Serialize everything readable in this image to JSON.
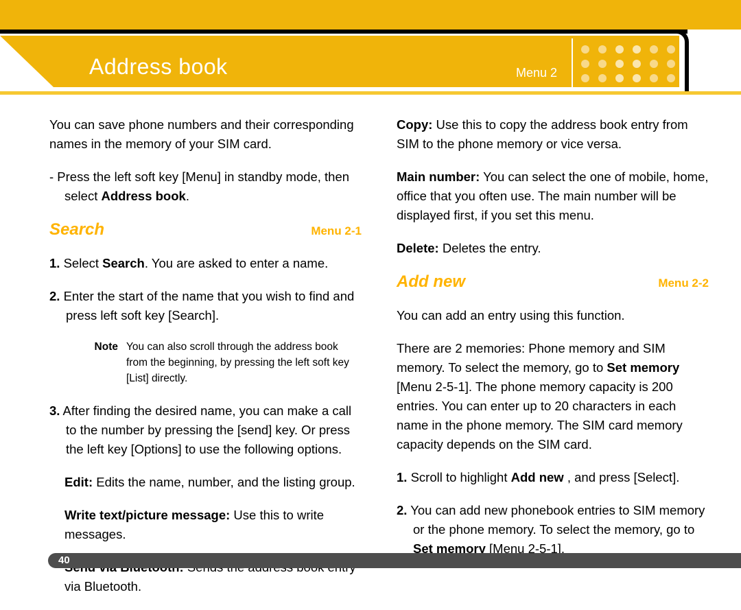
{
  "header": {
    "title": "Address book",
    "menu_tag": "Menu 2",
    "dot_rows": 3,
    "dot_cols": 6,
    "bar_color": "#F0B40A",
    "title_color": "#FFFFFF"
  },
  "theme": {
    "orange": "#F0B40A",
    "heading_orange": "#FFB300",
    "footer_gray": "#4D4D4D",
    "text_black": "#000000"
  },
  "left_column": {
    "intro": "You can save phone numbers and their corresponding names in the memory of your SIM card.",
    "bullet": {
      "prefix": "- Press the left soft key [Menu] in standby mode, then select ",
      "bold": "Address book",
      "suffix": "."
    },
    "section": {
      "title": "Search",
      "menu": "Menu 2-1"
    },
    "step1": {
      "num": "1.",
      "pre": " Select ",
      "bold": "Search",
      "post": ". You are asked to enter a name."
    },
    "step2": {
      "num": "2.",
      "text": " Enter the start of the name that you wish to find and press left soft key [Search]."
    },
    "note": {
      "label": "Note",
      "text": "You can also scroll through the address book from the beginning, by pressing the left soft key [List] directly."
    },
    "step3": {
      "num": "3.",
      "text": " After finding the desired name, you can make a call to the number by pressing the [send] key. Or press the left key [Options] to use the following options."
    },
    "options": [
      {
        "term": "Edit:",
        "desc": " Edits the name, number, and the listing group."
      },
      {
        "term": "Write text/picture message:",
        "desc": " Use this to write messages."
      },
      {
        "term": "Send via Bluetooth:",
        "desc": " Sends the address book entry via Bluetooth."
      }
    ]
  },
  "right_column": {
    "options": [
      {
        "term": "Copy:",
        "desc": " Use this to copy the address book entry from SIM to the phone memory or vice versa."
      },
      {
        "term": "Main number:",
        "desc": " You can select the one of mobile, home, office that you often use. The main number will be displayed first, if you set this menu."
      },
      {
        "term": "Delete:",
        "desc": " Deletes the entry."
      }
    ],
    "section": {
      "title": "Add new",
      "menu": "Menu 2-2"
    },
    "intro": "You can add an entry using this function.",
    "memory_para": {
      "pre": "There are 2 memories: Phone memory and SIM memory. To select the memory, go to ",
      "bold": "Set memory",
      "post": " [Menu 2-5-1]. The phone memory capacity is 200 entries. You can enter up to 20 characters in each name in the phone memory. The SIM card memory capacity depends on the SIM card."
    },
    "step1": {
      "num": "1.",
      "pre": " Scroll to highlight ",
      "bold": "Add new",
      "post": " , and press [Select]."
    },
    "step2": {
      "num": "2.",
      "pre": " You can add new phonebook entries to SIM memory or the phone memory. To select the memory, go to ",
      "bold": "Set memory",
      "post": " [Menu 2-5-1]."
    }
  },
  "footer": {
    "page_number": "40"
  }
}
